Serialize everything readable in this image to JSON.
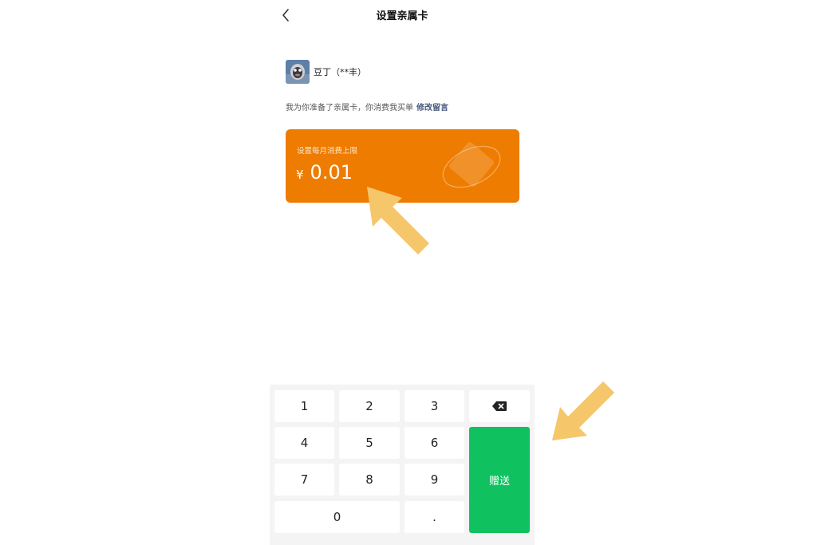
{
  "header": {
    "title": "设置亲属卡"
  },
  "user": {
    "name": "豆丁（**丰）"
  },
  "message": {
    "text": "我为你准备了亲属卡，你消费我买单",
    "edit_link": "修改留言"
  },
  "card": {
    "label": "设置每月消费上限",
    "currency": "¥",
    "amount": "0.01",
    "color": "#ee7c00"
  },
  "keypad": {
    "keys": [
      "1",
      "2",
      "3",
      "4",
      "5",
      "6",
      "7",
      "8",
      "9",
      "0",
      "."
    ],
    "send_label": "赠送",
    "send_color": "#0fc25f"
  },
  "annotations": {
    "arrow_color": "#f5c66a"
  }
}
